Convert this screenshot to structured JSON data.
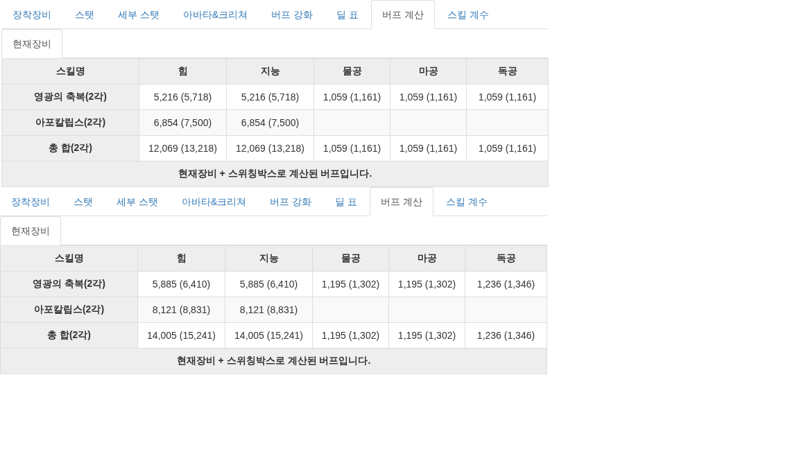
{
  "panels": [
    {
      "tabs": [
        {
          "label": "장착장비",
          "selected": false
        },
        {
          "label": "스탯",
          "selected": false
        },
        {
          "label": "세부 스탯",
          "selected": false
        },
        {
          "label": "아바타&크리쳐",
          "selected": false
        },
        {
          "label": "버프 강화",
          "selected": false
        },
        {
          "label": "딜 표",
          "selected": false
        },
        {
          "label": "버프 계산",
          "selected": true
        },
        {
          "label": "스킬 계수",
          "selected": false
        }
      ],
      "subtabs": [
        {
          "label": "현재장비",
          "selected": true
        }
      ],
      "table": {
        "columns": [
          "스킬명",
          "힘",
          "지능",
          "물공",
          "마공",
          "독공"
        ],
        "rows": [
          {
            "cells": [
              "영광의 축복(2각)",
              "5,216 (5,718)",
              "5,216 (5,718)",
              "1,059 (1,161)",
              "1,059 (1,161)",
              "1,059 (1,161)"
            ]
          },
          {
            "cells": [
              "아포칼립스(2각)",
              "6,854 (7,500)",
              "6,854 (7,500)"
            ]
          },
          {
            "cells": [
              "총 합(2각)",
              "12,069 (13,218)",
              "12,069 (13,218)",
              "1,059 (1,161)",
              "1,059 (1,161)",
              "1,059 (1,161)"
            ]
          }
        ],
        "footer": "현재장비 + 스위칭박스로 계산된 버프입니다."
      }
    },
    {
      "tabs": [
        {
          "label": "장착장비",
          "selected": false
        },
        {
          "label": "스탯",
          "selected": false
        },
        {
          "label": "세부 스탯",
          "selected": false
        },
        {
          "label": "아바타&크리쳐",
          "selected": false
        },
        {
          "label": "버프 강화",
          "selected": false
        },
        {
          "label": "딜 표",
          "selected": false
        },
        {
          "label": "버프 계산",
          "selected": true
        },
        {
          "label": "스킬 계수",
          "selected": false
        }
      ],
      "subtabs": [
        {
          "label": "현재장비",
          "selected": true
        }
      ],
      "table": {
        "columns": [
          "스킬명",
          "힘",
          "지능",
          "물공",
          "마공",
          "독공"
        ],
        "rows": [
          {
            "cells": [
              "영광의 축복(2각)",
              "5,885 (6,410)",
              "5,885 (6,410)",
              "1,195 (1,302)",
              "1,195 (1,302)",
              "1,236 (1,346)"
            ]
          },
          {
            "cells": [
              "아포칼립스(2각)",
              "8,121 (8,831)",
              "8,121 (8,831)"
            ]
          },
          {
            "cells": [
              "총 합(2각)",
              "14,005 (15,241)",
              "14,005 (15,241)",
              "1,195 (1,302)",
              "1,195 (1,302)",
              "1,236 (1,346)"
            ]
          }
        ],
        "footer": "현재장비 + 스위칭박스로 계산된 버프입니다."
      }
    }
  ]
}
